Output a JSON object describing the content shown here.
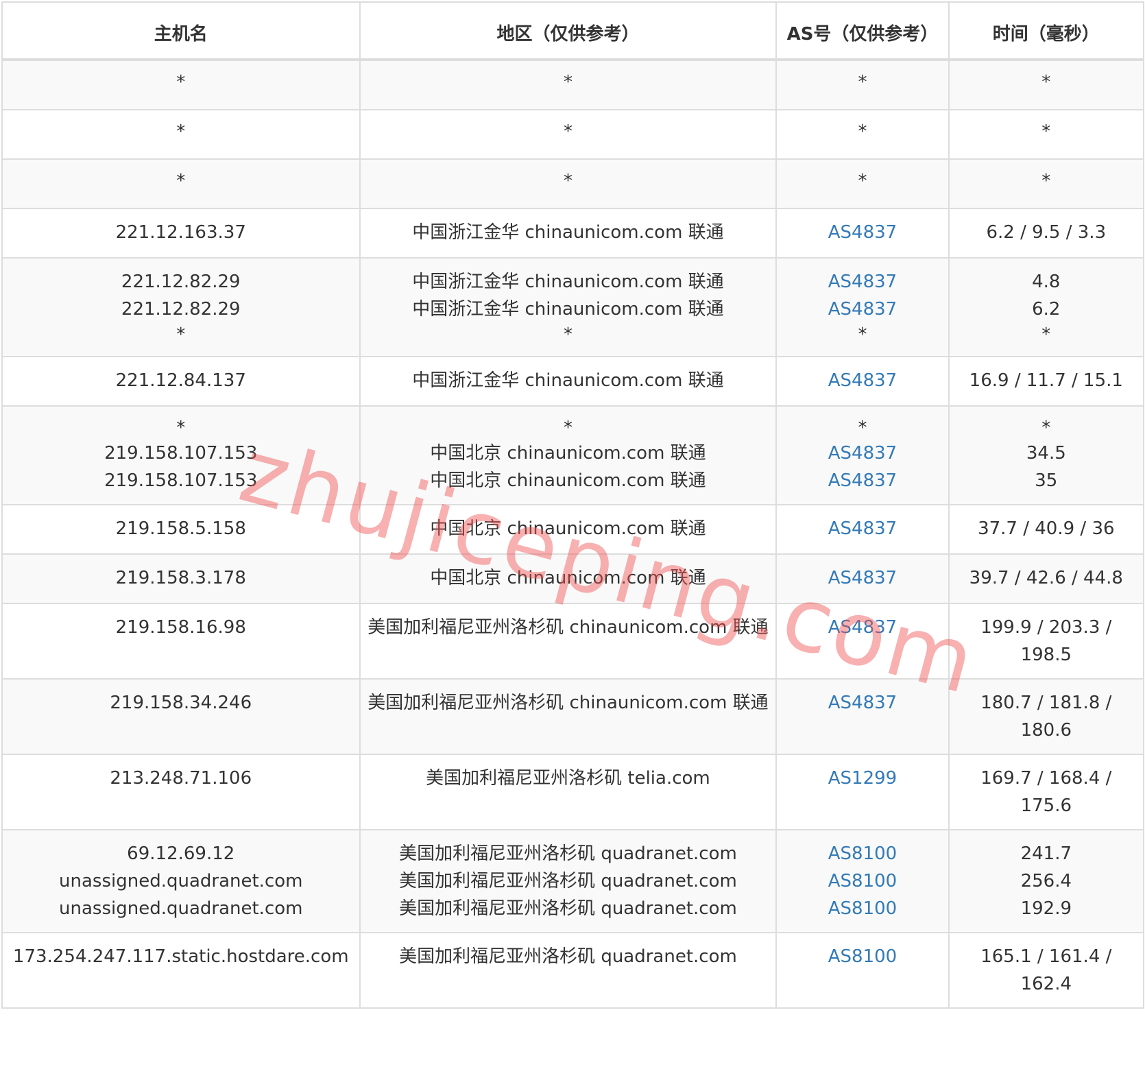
{
  "table": {
    "headers": {
      "host": "主机名",
      "region": "地区（仅供参考）",
      "as": "AS号（仅供参考）",
      "time": "时间（毫秒）"
    },
    "rows": [
      {
        "host": [
          "*"
        ],
        "region": [
          "*"
        ],
        "as": [
          "*"
        ],
        "time": [
          "*"
        ]
      },
      {
        "host": [
          "*"
        ],
        "region": [
          "*"
        ],
        "as": [
          "*"
        ],
        "time": [
          "*"
        ]
      },
      {
        "host": [
          "*"
        ],
        "region": [
          "*"
        ],
        "as": [
          "*"
        ],
        "time": [
          "*"
        ]
      },
      {
        "host": [
          "221.12.163.37"
        ],
        "region": [
          "中国浙江金华 chinaunicom.com 联通"
        ],
        "as": [
          "AS4837"
        ],
        "time": [
          "6.2 / 9.5 / 3.3"
        ]
      },
      {
        "host": [
          "221.12.82.29",
          "221.12.82.29",
          "*"
        ],
        "region": [
          "中国浙江金华 chinaunicom.com 联通",
          "中国浙江金华 chinaunicom.com 联通",
          "*"
        ],
        "as": [
          "AS4837",
          "AS4837",
          "*"
        ],
        "time": [
          "4.8",
          "6.2",
          "*"
        ]
      },
      {
        "host": [
          "221.12.84.137"
        ],
        "region": [
          "中国浙江金华 chinaunicom.com 联通"
        ],
        "as": [
          "AS4837"
        ],
        "time": [
          "16.9 / 11.7 / 15.1"
        ]
      },
      {
        "host": [
          "*",
          "219.158.107.153",
          "219.158.107.153"
        ],
        "region": [
          "*",
          "中国北京 chinaunicom.com 联通",
          "中国北京 chinaunicom.com 联通"
        ],
        "as": [
          "*",
          "AS4837",
          "AS4837"
        ],
        "time": [
          "*",
          "34.5",
          "35"
        ]
      },
      {
        "host": [
          "219.158.5.158"
        ],
        "region": [
          "中国北京 chinaunicom.com 联通"
        ],
        "as": [
          "AS4837"
        ],
        "time": [
          "37.7 / 40.9 / 36"
        ]
      },
      {
        "host": [
          "219.158.3.178"
        ],
        "region": [
          "中国北京 chinaunicom.com 联通"
        ],
        "as": [
          "AS4837"
        ],
        "time": [
          "39.7 / 42.6 / 44.8"
        ]
      },
      {
        "host": [
          "219.158.16.98"
        ],
        "region": [
          "美国加利福尼亚州洛杉矶 chinaunicom.com 联通"
        ],
        "as": [
          "AS4837"
        ],
        "time": [
          "199.9 / 203.3 / 198.5"
        ]
      },
      {
        "host": [
          "219.158.34.246"
        ],
        "region": [
          "美国加利福尼亚州洛杉矶 chinaunicom.com 联通"
        ],
        "as": [
          "AS4837"
        ],
        "time": [
          "180.7 / 181.8 / 180.6"
        ]
      },
      {
        "host": [
          "213.248.71.106"
        ],
        "region": [
          "美国加利福尼亚州洛杉矶 telia.com"
        ],
        "as": [
          "AS1299"
        ],
        "time": [
          "169.7 / 168.4 / 175.6"
        ]
      },
      {
        "host": [
          "69.12.69.12",
          "unassigned.quadranet.com",
          "unassigned.quadranet.com"
        ],
        "region": [
          "美国加利福尼亚州洛杉矶 quadranet.com",
          "美国加利福尼亚州洛杉矶 quadranet.com",
          "美国加利福尼亚州洛杉矶 quadranet.com"
        ],
        "as": [
          "AS8100",
          "AS8100",
          "AS8100"
        ],
        "time": [
          "241.7",
          "256.4",
          "192.9"
        ]
      },
      {
        "host": [
          "173.254.247.117.static.hostdare.com"
        ],
        "region": [
          "美国加利福尼亚州洛杉矶 quadranet.com"
        ],
        "as": [
          "AS8100"
        ],
        "time": [
          "165.1 / 161.4 / 162.4"
        ]
      }
    ]
  },
  "watermark": "zhujiceping.com",
  "colors": {
    "link": "#337ab7",
    "border": "#dddddd",
    "stripe": "#f9f9f9",
    "watermark": "#f05050"
  }
}
